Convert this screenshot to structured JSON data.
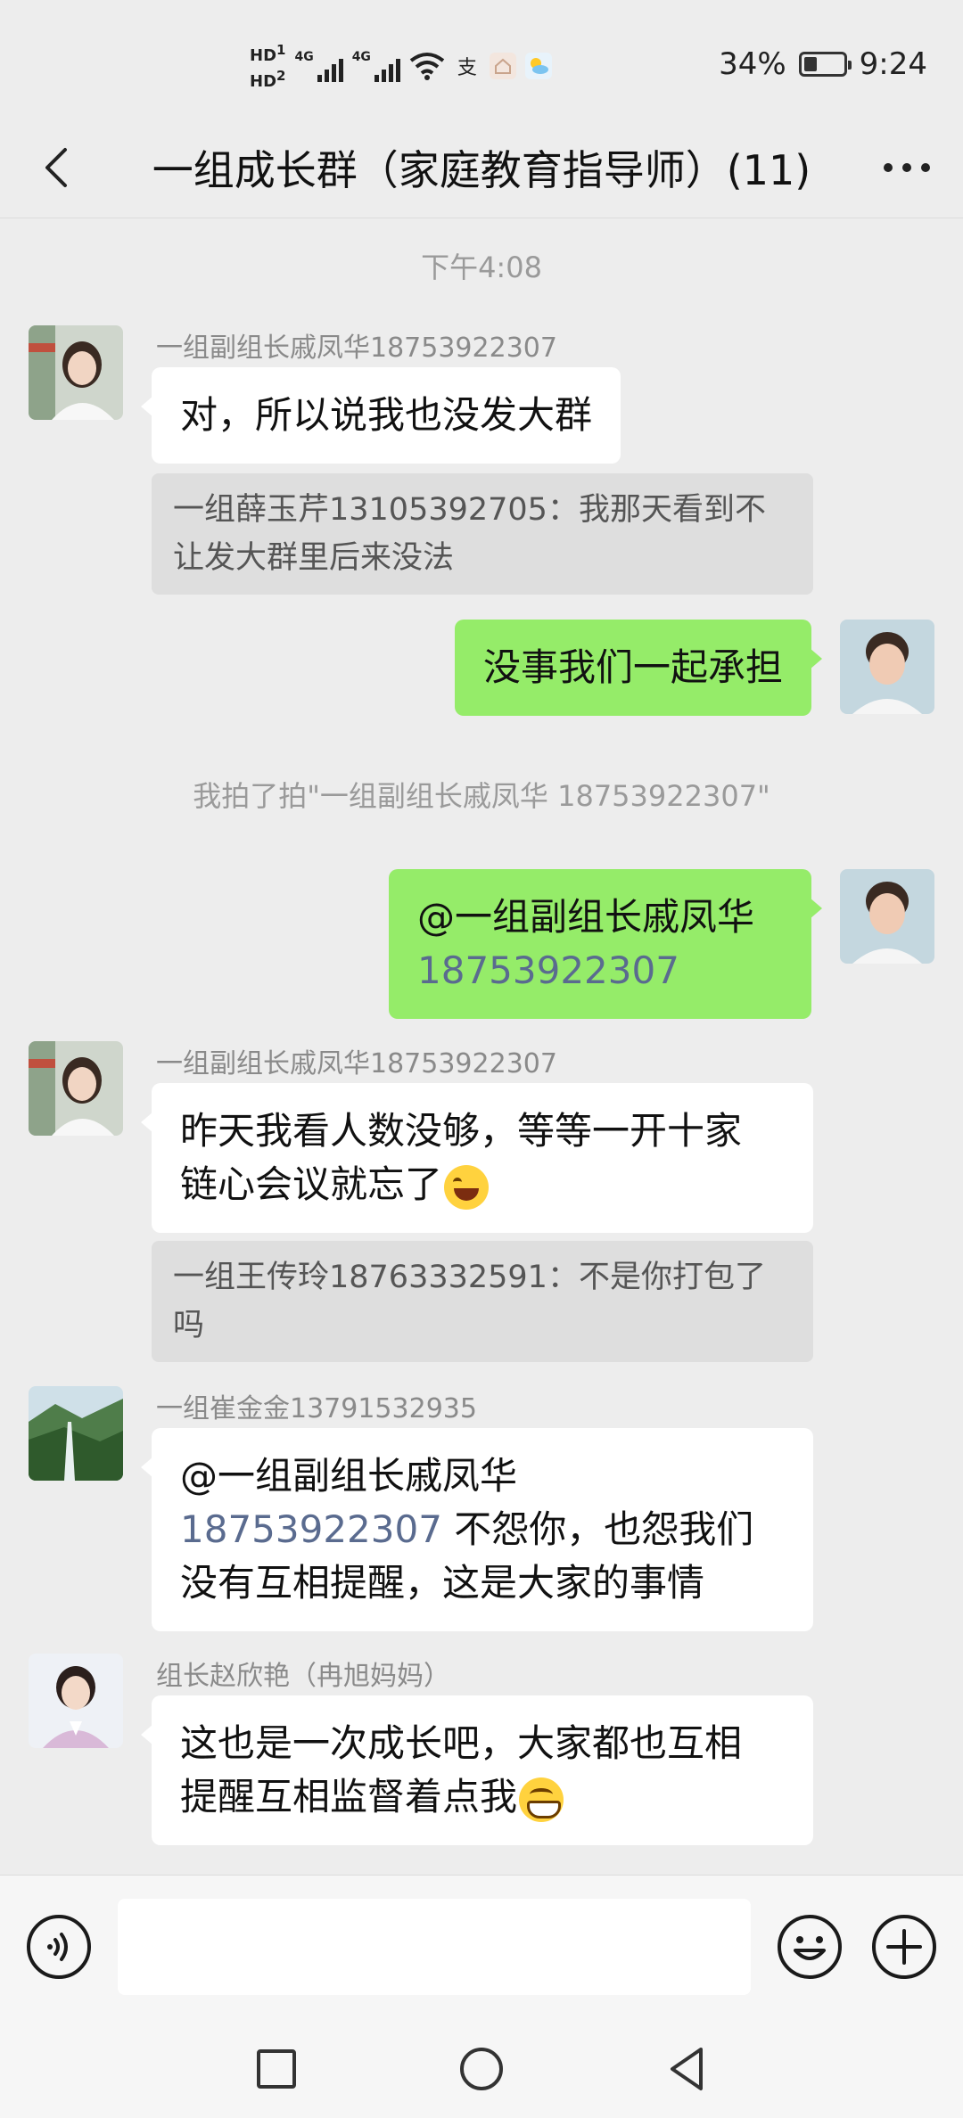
{
  "status_bar": {
    "hd1": "HD",
    "hd1_sub": "1",
    "hd2": "HD",
    "hd2_sub": "2",
    "net1": "4G",
    "net2": "4G",
    "alipay_icon": "支",
    "battery_percent_text": "34%",
    "battery_level": 0.34,
    "time": "9:24"
  },
  "header": {
    "back_icon": "chevron-left-icon",
    "title": "一组成长群（家庭教育指导师）(11)",
    "more_icon": "more-dots-icon"
  },
  "chat": {
    "time_separator": "下午4:08",
    "messages": [
      {
        "type": "incoming",
        "sender": "一组副组长戚凤华18753922307",
        "text": "对，所以说我也没发大群",
        "quote": "一组薛玉芹13105392705：我那天看到不让发大群里后来没法"
      },
      {
        "type": "outgoing",
        "text": "没事我们一起承担"
      },
      {
        "type": "system",
        "text": "我拍了拍\"一组副组长戚凤华 18753922307\""
      },
      {
        "type": "outgoing",
        "mention_name": "@一组副组长戚凤华",
        "mention_number": "18753922307"
      },
      {
        "type": "incoming",
        "sender": "一组副组长戚凤华18753922307",
        "line1": "昨天我看人数没够，等等一开十家",
        "line2": "链心会议就忘了",
        "emoji": "tears-of-joy-emoji",
        "quote": "一组王传玲18763332591：不是你打包了吗"
      },
      {
        "type": "incoming",
        "sender": "一组崔金金13791532935",
        "mention_name": "@一组副组长戚凤华",
        "mention_number": "18753922307",
        "after_mention": " 不怨你，也怨我们",
        "line3": "没有互相提醒，这是大家的事情"
      },
      {
        "type": "incoming",
        "sender": "组长赵欣艳（冉旭妈妈）",
        "line1": "这也是一次成长吧，大家都也互相",
        "line2": "提醒互相监督着点我",
        "emoji": "grinning-emoji"
      }
    ]
  },
  "input_bar": {
    "voice_icon": "voice-icon",
    "text_value": "",
    "emoji_icon": "smile-icon",
    "plus_icon": "plus-icon"
  },
  "system_nav": {
    "recent": "square-icon",
    "home": "circle-icon",
    "back": "triangle-back-icon"
  },
  "colors": {
    "background": "#ededed",
    "outgoing_bubble": "#95ec69",
    "incoming_bubble": "#ffffff",
    "quote_bg": "#dedede",
    "mention_number": "#5a6b8f"
  }
}
